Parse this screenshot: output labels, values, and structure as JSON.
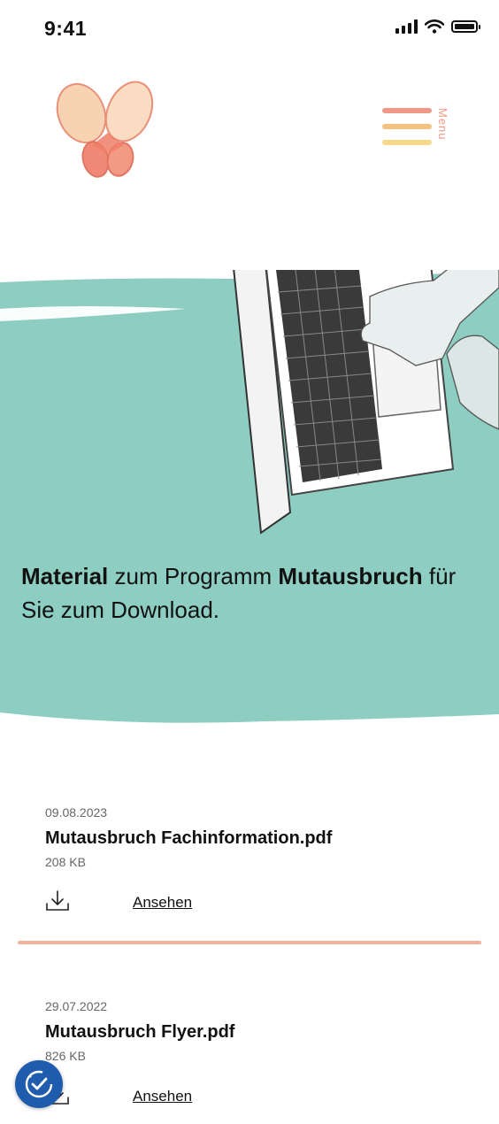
{
  "status_bar": {
    "time": "9:41"
  },
  "header": {
    "menu_label": "Menu"
  },
  "hero": {
    "intro_bold_1": "Material",
    "intro_text_1": " zum Programm ",
    "intro_bold_2": "Mutausbruch",
    "intro_text_2": " für Sie zum Download."
  },
  "documents": [
    {
      "date": "09.08.2023",
      "title": "Mutausbruch Fachinformation.pdf",
      "size": "208 KB",
      "view_label": "Ansehen"
    },
    {
      "date": "29.07.2022",
      "title": "Mutausbruch Flyer.pdf",
      "size": "826 KB",
      "view_label": "Ansehen"
    }
  ],
  "colors": {
    "teal": "#8ecec2",
    "menu_coral": "#ef9a86",
    "menu_orange": "#f4c27f",
    "menu_yellow": "#f6d98a",
    "a11y_blue": "#1f5cae"
  },
  "icons": [
    "signal-icon",
    "wifi-icon",
    "battery-icon",
    "butterfly-logo",
    "menu-icon",
    "download-icon",
    "accessibility-icon"
  ]
}
